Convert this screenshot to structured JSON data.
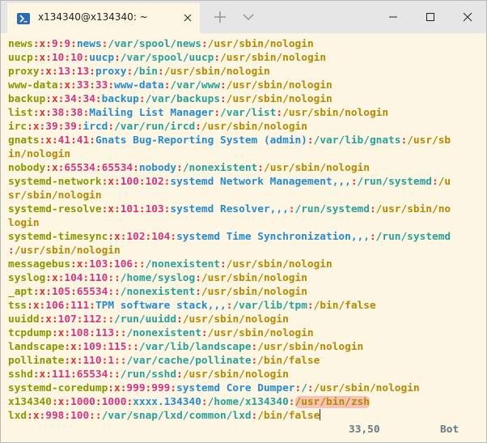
{
  "window": {
    "tab_title": "x134340@x134340: ~"
  },
  "colors": {
    "username": "#859900",
    "separator": "#dc322f",
    "numbers": "#d33682",
    "gecos": "#268bd2",
    "home": "#2aa198",
    "shell": "#b58900",
    "background": "#fdf6e3"
  },
  "terminal": {
    "lines": [
      [
        [
          "news",
          "f"
        ],
        [
          ":x:",
          "s"
        ],
        [
          "9",
          "n"
        ],
        [
          ":",
          "s"
        ],
        [
          "9",
          "n"
        ],
        [
          ":",
          "s"
        ],
        [
          "news",
          "g"
        ],
        [
          ":",
          "s"
        ],
        [
          "/var/spool/news",
          "h"
        ],
        [
          ":",
          "s"
        ],
        [
          "/usr/sbin/nologin",
          "sh"
        ]
      ],
      [
        [
          "uucp",
          "f"
        ],
        [
          ":x:",
          "s"
        ],
        [
          "10",
          "n"
        ],
        [
          ":",
          "s"
        ],
        [
          "10",
          "n"
        ],
        [
          ":",
          "s"
        ],
        [
          "uucp",
          "g"
        ],
        [
          ":",
          "s"
        ],
        [
          "/var/spool/uucp",
          "h"
        ],
        [
          ":",
          "s"
        ],
        [
          "/usr/sbin/nologin",
          "sh"
        ]
      ],
      [
        [
          "proxy",
          "f"
        ],
        [
          ":x:",
          "s"
        ],
        [
          "13",
          "n"
        ],
        [
          ":",
          "s"
        ],
        [
          "13",
          "n"
        ],
        [
          ":",
          "s"
        ],
        [
          "proxy",
          "g"
        ],
        [
          ":",
          "s"
        ],
        [
          "/bin",
          "h"
        ],
        [
          ":",
          "s"
        ],
        [
          "/usr/sbin/nologin",
          "sh"
        ]
      ],
      [
        [
          "www-data",
          "f"
        ],
        [
          ":x:",
          "s"
        ],
        [
          "33",
          "n"
        ],
        [
          ":",
          "s"
        ],
        [
          "33",
          "n"
        ],
        [
          ":",
          "s"
        ],
        [
          "www-data",
          "g"
        ],
        [
          ":",
          "s"
        ],
        [
          "/var/www",
          "h"
        ],
        [
          ":",
          "s"
        ],
        [
          "/usr/sbin/nologin",
          "sh"
        ]
      ],
      [
        [
          "backup",
          "f"
        ],
        [
          ":x:",
          "s"
        ],
        [
          "34",
          "n"
        ],
        [
          ":",
          "s"
        ],
        [
          "34",
          "n"
        ],
        [
          ":",
          "s"
        ],
        [
          "backup",
          "g"
        ],
        [
          ":",
          "s"
        ],
        [
          "/var/backups",
          "h"
        ],
        [
          ":",
          "s"
        ],
        [
          "/usr/sbin/nologin",
          "sh"
        ]
      ],
      [
        [
          "list",
          "f"
        ],
        [
          ":x:",
          "s"
        ],
        [
          "38",
          "n"
        ],
        [
          ":",
          "s"
        ],
        [
          "38",
          "n"
        ],
        [
          ":",
          "s"
        ],
        [
          "Mailing List Manager",
          "g"
        ],
        [
          ":",
          "s"
        ],
        [
          "/var/list",
          "h"
        ],
        [
          ":",
          "s"
        ],
        [
          "/usr/sbin/nologin",
          "sh"
        ]
      ],
      [
        [
          "irc",
          "f"
        ],
        [
          ":x:",
          "s"
        ],
        [
          "39",
          "n"
        ],
        [
          ":",
          "s"
        ],
        [
          "39",
          "n"
        ],
        [
          ":",
          "s"
        ],
        [
          "ircd",
          "g"
        ],
        [
          ":",
          "s"
        ],
        [
          "/var/run/ircd",
          "h"
        ],
        [
          ":",
          "s"
        ],
        [
          "/usr/sbin/nologin",
          "sh"
        ]
      ],
      [
        [
          "gnats",
          "f"
        ],
        [
          ":x:",
          "s"
        ],
        [
          "41",
          "n"
        ],
        [
          ":",
          "s"
        ],
        [
          "41",
          "n"
        ],
        [
          ":",
          "s"
        ],
        [
          "Gnats Bug-Reporting System (admin)",
          "g"
        ],
        [
          ":",
          "s"
        ],
        [
          "/var/lib/gnats",
          "h"
        ],
        [
          ":",
          "s"
        ],
        [
          "/usr/sb",
          "sh"
        ]
      ],
      [
        [
          "in/nologin",
          "sh"
        ]
      ],
      [
        [
          "nobody",
          "f"
        ],
        [
          ":x:",
          "s"
        ],
        [
          "65534",
          "n"
        ],
        [
          ":",
          "s"
        ],
        [
          "65534",
          "n"
        ],
        [
          ":",
          "s"
        ],
        [
          "nobody",
          "g"
        ],
        [
          ":",
          "s"
        ],
        [
          "/nonexistent",
          "h"
        ],
        [
          ":",
          "s"
        ],
        [
          "/usr/sbin/nologin",
          "sh"
        ]
      ],
      [
        [
          "systemd-network",
          "f"
        ],
        [
          ":x:",
          "s"
        ],
        [
          "100",
          "n"
        ],
        [
          ":",
          "s"
        ],
        [
          "102",
          "n"
        ],
        [
          ":",
          "s"
        ],
        [
          "systemd Network Management,,,",
          "g"
        ],
        [
          ":",
          "s"
        ],
        [
          "/run/systemd",
          "h"
        ],
        [
          ":",
          "s"
        ],
        [
          "/u",
          "sh"
        ]
      ],
      [
        [
          "sr/sbin/nologin",
          "sh"
        ]
      ],
      [
        [
          "systemd-resolve",
          "f"
        ],
        [
          ":x:",
          "s"
        ],
        [
          "101",
          "n"
        ],
        [
          ":",
          "s"
        ],
        [
          "103",
          "n"
        ],
        [
          ":",
          "s"
        ],
        [
          "systemd Resolver,,,",
          "g"
        ],
        [
          ":",
          "s"
        ],
        [
          "/run/systemd",
          "h"
        ],
        [
          ":",
          "s"
        ],
        [
          "/usr/sbin/no",
          "sh"
        ]
      ],
      [
        [
          "login",
          "sh"
        ]
      ],
      [
        [
          "systemd-timesync",
          "f"
        ],
        [
          ":x:",
          "s"
        ],
        [
          "102",
          "n"
        ],
        [
          ":",
          "s"
        ],
        [
          "104",
          "n"
        ],
        [
          ":",
          "s"
        ],
        [
          "systemd Time Synchronization,,,",
          "g"
        ],
        [
          ":",
          "s"
        ],
        [
          "/run/systemd",
          "h"
        ]
      ],
      [
        [
          ":",
          "s"
        ],
        [
          "/usr/sbin/nologin",
          "sh"
        ]
      ],
      [
        [
          "messagebus",
          "f"
        ],
        [
          ":x:",
          "s"
        ],
        [
          "103",
          "n"
        ],
        [
          ":",
          "s"
        ],
        [
          "106",
          "n"
        ],
        [
          "::",
          "s"
        ],
        [
          "/nonexistent",
          "h"
        ],
        [
          ":",
          "s"
        ],
        [
          "/usr/sbin/nologin",
          "sh"
        ]
      ],
      [
        [
          "syslog",
          "f"
        ],
        [
          ":x:",
          "s"
        ],
        [
          "104",
          "n"
        ],
        [
          ":",
          "s"
        ],
        [
          "110",
          "n"
        ],
        [
          "::",
          "s"
        ],
        [
          "/home/syslog",
          "h"
        ],
        [
          ":",
          "s"
        ],
        [
          "/usr/sbin/nologin",
          "sh"
        ]
      ],
      [
        [
          "_apt",
          "f"
        ],
        [
          ":x:",
          "s"
        ],
        [
          "105",
          "n"
        ],
        [
          ":",
          "s"
        ],
        [
          "65534",
          "n"
        ],
        [
          "::",
          "s"
        ],
        [
          "/nonexistent",
          "h"
        ],
        [
          ":",
          "s"
        ],
        [
          "/usr/sbin/nologin",
          "sh"
        ]
      ],
      [
        [
          "tss",
          "f"
        ],
        [
          ":x:",
          "s"
        ],
        [
          "106",
          "n"
        ],
        [
          ":",
          "s"
        ],
        [
          "111",
          "n"
        ],
        [
          ":",
          "s"
        ],
        [
          "TPM software stack,,,",
          "g"
        ],
        [
          ":",
          "s"
        ],
        [
          "/var/lib/tpm",
          "h"
        ],
        [
          ":",
          "s"
        ],
        [
          "/bin/false",
          "sh"
        ]
      ],
      [
        [
          "uuidd",
          "f"
        ],
        [
          ":x:",
          "s"
        ],
        [
          "107",
          "n"
        ],
        [
          ":",
          "s"
        ],
        [
          "112",
          "n"
        ],
        [
          "::",
          "s"
        ],
        [
          "/run/uuidd",
          "h"
        ],
        [
          ":",
          "s"
        ],
        [
          "/usr/sbin/nologin",
          "sh"
        ]
      ],
      [
        [
          "tcpdump",
          "f"
        ],
        [
          ":x:",
          "s"
        ],
        [
          "108",
          "n"
        ],
        [
          ":",
          "s"
        ],
        [
          "113",
          "n"
        ],
        [
          "::",
          "s"
        ],
        [
          "/nonexistent",
          "h"
        ],
        [
          ":",
          "s"
        ],
        [
          "/usr/sbin/nologin",
          "sh"
        ]
      ],
      [
        [
          "landscape",
          "f"
        ],
        [
          ":x:",
          "s"
        ],
        [
          "109",
          "n"
        ],
        [
          ":",
          "s"
        ],
        [
          "115",
          "n"
        ],
        [
          "::",
          "s"
        ],
        [
          "/var/lib/landscape",
          "h"
        ],
        [
          ":",
          "s"
        ],
        [
          "/usr/sbin/nologin",
          "sh"
        ]
      ],
      [
        [
          "pollinate",
          "f"
        ],
        [
          ":x:",
          "s"
        ],
        [
          "110",
          "n"
        ],
        [
          ":",
          "s"
        ],
        [
          "1",
          "n"
        ],
        [
          "::",
          "s"
        ],
        [
          "/var/cache/pollinate",
          "h"
        ],
        [
          ":",
          "s"
        ],
        [
          "/bin/false",
          "sh"
        ]
      ],
      [
        [
          "sshd",
          "f"
        ],
        [
          ":x:",
          "s"
        ],
        [
          "111",
          "n"
        ],
        [
          ":",
          "s"
        ],
        [
          "65534",
          "n"
        ],
        [
          "::",
          "s"
        ],
        [
          "/run/sshd",
          "h"
        ],
        [
          ":",
          "s"
        ],
        [
          "/usr/sbin/nologin",
          "sh"
        ]
      ],
      [
        [
          "systemd-coredump",
          "f"
        ],
        [
          ":x:",
          "s"
        ],
        [
          "999",
          "n"
        ],
        [
          ":",
          "s"
        ],
        [
          "999",
          "n"
        ],
        [
          ":",
          "s"
        ],
        [
          "systemd Core Dumper",
          "g"
        ],
        [
          ":",
          "s"
        ],
        [
          "/",
          "h"
        ],
        [
          ":",
          "s"
        ],
        [
          "/usr/sbin/nologin",
          "sh"
        ]
      ],
      [
        [
          "x134340",
          "f"
        ],
        [
          ":x:",
          "s"
        ],
        [
          "1000",
          "n"
        ],
        [
          ":",
          "s"
        ],
        [
          "1000",
          "n"
        ],
        [
          ":",
          "s"
        ],
        [
          "xxxx.134340",
          "g"
        ],
        [
          ":",
          "s"
        ],
        [
          "/home/x134340",
          "h"
        ],
        [
          ":",
          "s"
        ],
        [
          "/usr/bin/zsh",
          "sh hl"
        ]
      ],
      [
        [
          "lxd",
          "f"
        ],
        [
          ":x:",
          "s"
        ],
        [
          "998",
          "n"
        ],
        [
          ":",
          "s"
        ],
        [
          "100",
          "n"
        ],
        [
          "::",
          "s"
        ],
        [
          "/var/snap/lxd/common/lxd",
          "h"
        ],
        [
          ":",
          "s"
        ],
        [
          "/bin/false",
          "sh"
        ]
      ]
    ],
    "cursor_position": "33,50",
    "scroll_indicator": "Bot"
  }
}
